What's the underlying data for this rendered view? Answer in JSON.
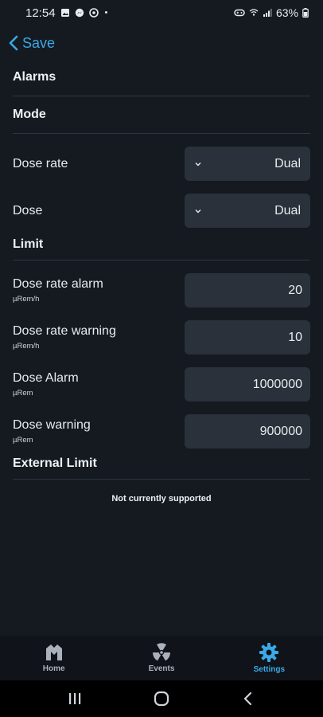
{
  "status_bar": {
    "time": "12:54",
    "dot": "•",
    "battery": "63%"
  },
  "header": {
    "back_label": "Save"
  },
  "sections": {
    "alarms": "Alarms",
    "mode": "Mode",
    "limit": "Limit",
    "external_limit": "External Limit"
  },
  "mode": {
    "dose_rate": {
      "label": "Dose rate",
      "value": "Dual"
    },
    "dose": {
      "label": "Dose",
      "value": "Dual"
    }
  },
  "limits": [
    {
      "label": "Dose rate alarm",
      "unit": "µRem/h",
      "value": "20"
    },
    {
      "label": "Dose rate warning",
      "unit": "µRem/h",
      "value": "10"
    },
    {
      "label": "Dose Alarm",
      "unit": "µRem",
      "value": "1000000"
    },
    {
      "label": "Dose warning",
      "unit": "µRem",
      "value": "900000"
    }
  ],
  "external_limit_note": "Not currently supported",
  "bottom_nav": [
    {
      "label": "Home",
      "icon": "home-logo-icon",
      "active": false
    },
    {
      "label": "Events",
      "icon": "radiation-icon",
      "active": false
    },
    {
      "label": "Settings",
      "icon": "gear-icon",
      "active": true
    }
  ],
  "colors": {
    "background": "#151a21",
    "accent": "#3aa9e6",
    "field": "#2a313a",
    "nav_background": "#10141a"
  }
}
